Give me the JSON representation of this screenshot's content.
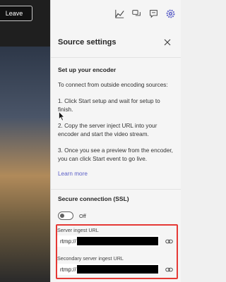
{
  "left": {
    "leave_label": "Leave"
  },
  "toolbar": {
    "icons": [
      "chart-icon",
      "chat-bubbles-icon",
      "message-icon",
      "gear-icon"
    ]
  },
  "panel": {
    "title": "Source settings",
    "setup_title": "Set up your encoder",
    "intro": "To connect from outside encoding sources:",
    "steps": [
      "1. Click Start setup and wait for setup to finish.",
      "2. Copy the server inject URL into your encoder and start the video stream.",
      "3. Once you see a preview from the encoder, you can click Start event to go live."
    ],
    "learn_more": "Learn more",
    "ssl_title": "Secure connection (SSL)",
    "ssl_toggle_label": "Off",
    "server_ingest_label": "Server ingest URL",
    "server_ingest_value": "rtmp://",
    "secondary_ingest_label": "Secondary server ingest URL",
    "secondary_ingest_value": "rtmp://"
  },
  "colors": {
    "accent": "#5b5fc7",
    "highlight_box": "#e53935",
    "panel_bg": "#f5f5f5"
  }
}
